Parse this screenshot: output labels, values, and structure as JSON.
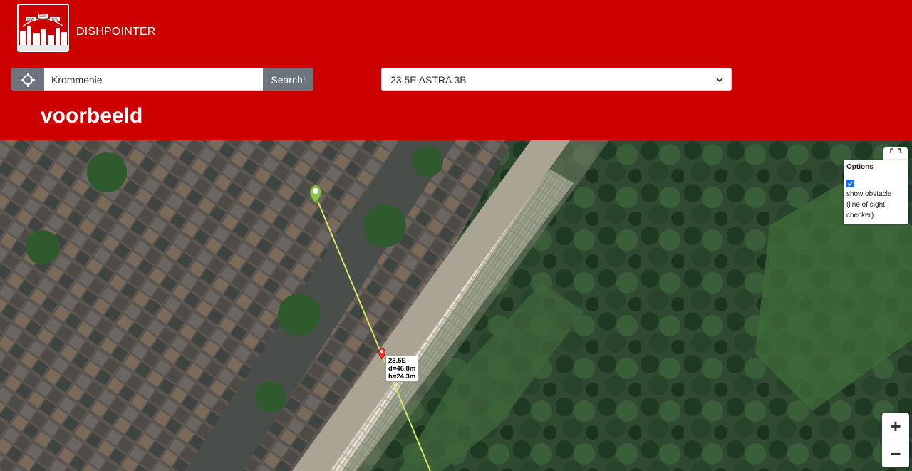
{
  "header": {
    "brand": "DISHPOINTER",
    "logo": {
      "labels": [
        "82W",
        "91W",
        "11W"
      ]
    },
    "page_title": "voorbeeld"
  },
  "search": {
    "value": "Krommenie",
    "button_label": "Search!",
    "locate_icon": "crosshair-icon"
  },
  "satellite_select": {
    "selected": "23.5E ASTRA 3B"
  },
  "map": {
    "options": {
      "title": "Options",
      "show_obstacle_checked": true,
      "show_obstacle_label": "show obstacle (line of sight checker)"
    },
    "obstacle_label": {
      "line1": "23.5E",
      "line2": "d=46.8m",
      "line3": "h=24.3m"
    },
    "zoom_in": "+",
    "zoom_out": "−",
    "colors": {
      "line_of_sight": "#d4e86a",
      "dish_marker": "#8bc34a",
      "obstacle_marker": "#e53935"
    }
  }
}
